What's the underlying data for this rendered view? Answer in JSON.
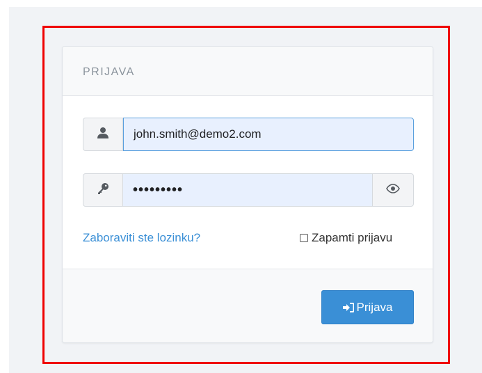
{
  "login": {
    "title": "PRIJAVA",
    "username_value": "john.smith@demo2.com",
    "password_value": "•••••••••",
    "forgot_link": "Zaboraviti ste lozinku?",
    "remember_label": "Zapamti prijavu",
    "remember_checked": false,
    "submit_label": "Prijava"
  },
  "icons": {
    "username": "user-icon",
    "password": "key-icon",
    "toggle": "eye-icon",
    "submit": "sign-in-icon"
  },
  "colors": {
    "accent": "#3a8fd6",
    "highlight": "#ef0000",
    "autofill_bg": "#e8f0fe"
  }
}
